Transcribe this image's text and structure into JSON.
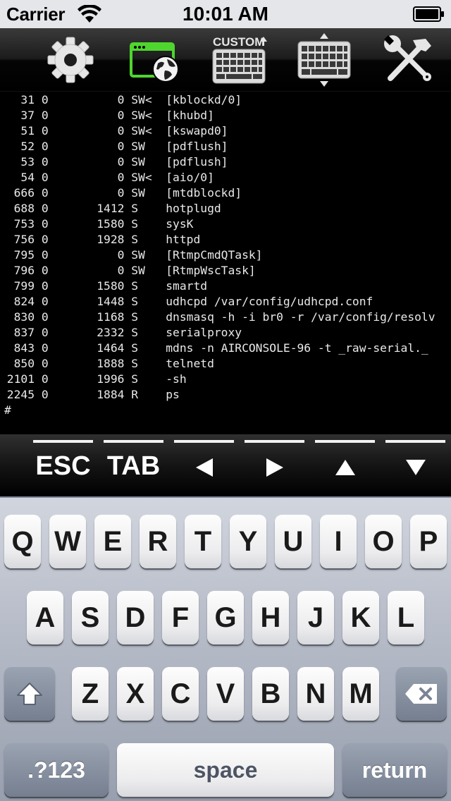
{
  "status_bar": {
    "carrier": "Carrier",
    "time": "10:01 AM",
    "icons": [
      "wifi-icon",
      "battery-icon"
    ]
  },
  "toolbar": {
    "buttons": [
      {
        "name": "settings",
        "icon": "gear-icon"
      },
      {
        "name": "connection",
        "icon": "browser-globe-icon",
        "active": true,
        "accent": "#4fd62e"
      },
      {
        "name": "custom-keyboard",
        "icon": "custom-keyboard-icon",
        "label": "CUSTOM"
      },
      {
        "name": "keyboard-resize",
        "icon": "keyboard-resize-icon"
      },
      {
        "name": "tools",
        "icon": "wrench-hammer-icon"
      }
    ]
  },
  "terminal": {
    "lines": [
      "   31 0          0 SW<  [kblockd/0]",
      "   37 0          0 SW<  [khubd]",
      "   51 0          0 SW<  [kswapd0]",
      "   52 0          0 SW   [pdflush]",
      "   53 0          0 SW   [pdflush]",
      "   54 0          0 SW<  [aio/0]",
      "  666 0          0 SW   [mtdblockd]",
      "  688 0       1412 S    hotplugd",
      "  753 0       1580 S    sysK",
      "  756 0       1928 S    httpd",
      "  795 0          0 SW   [RtmpCmdQTask]",
      "  796 0          0 SW   [RtmpWscTask]",
      "  799 0       1580 S    smartd",
      "  824 0       1448 S    udhcpd /var/config/udhcpd.conf",
      "  830 0       1168 S    dnsmasq -h -i br0 -r /var/config/resolv",
      "  837 0       2332 S    serialproxy",
      "  843 0       1464 S    mdns -n AIRCONSOLE-96 -t _raw-serial._",
      "  850 0       1888 S    telnetd",
      " 2101 0       1996 S    -sh",
      " 2245 0       1884 R    ps"
    ],
    "prompt": "#"
  },
  "special_keys": [
    {
      "label": "ESC",
      "icon": ""
    },
    {
      "label": "TAB",
      "icon": ""
    },
    {
      "label": "",
      "icon": "arrow-left-icon"
    },
    {
      "label": "",
      "icon": "arrow-right-icon"
    },
    {
      "label": "",
      "icon": "arrow-up-icon"
    },
    {
      "label": "",
      "icon": "arrow-down-icon"
    }
  ],
  "keyboard": {
    "row1": [
      "Q",
      "W",
      "E",
      "R",
      "T",
      "Y",
      "U",
      "I",
      "O",
      "P"
    ],
    "row2": [
      "A",
      "S",
      "D",
      "F",
      "G",
      "H",
      "J",
      "K",
      "L"
    ],
    "row3": [
      "Z",
      "X",
      "C",
      "V",
      "B",
      "N",
      "M"
    ],
    "numbers_label": ".?123",
    "space_label": "space",
    "return_label": "return"
  }
}
